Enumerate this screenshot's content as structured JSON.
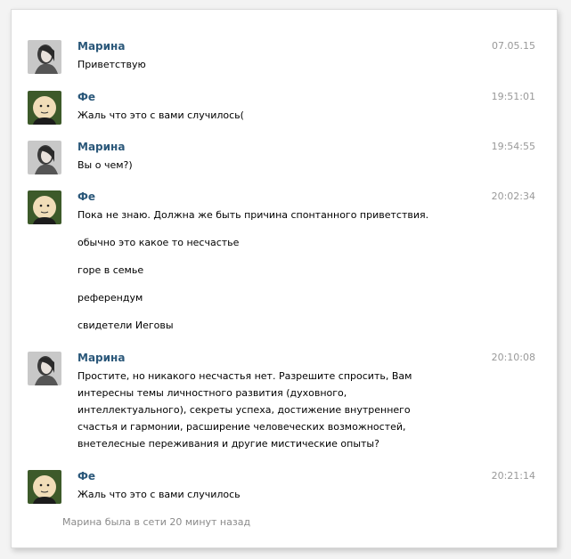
{
  "messages": [
    {
      "sender": "Марина",
      "time": "07.05.15",
      "lines": [
        "Приветствую"
      ]
    },
    {
      "sender": "Фе",
      "time": "19:51:01",
      "lines": [
        "Жаль что это с вами случилось("
      ]
    },
    {
      "sender": "Марина",
      "time": "19:54:55",
      "lines": [
        "Вы о чем?)"
      ]
    },
    {
      "sender": "Фе",
      "time": "20:02:34",
      "lines": [
        "Пока не знаю. Должна же быть причина спонтанного приветствия.",
        "обычно это какое то несчастье",
        "горе в семье",
        "референдум",
        "свидетели Иеговы"
      ]
    },
    {
      "sender": "Марина",
      "time": "20:10:08",
      "lines": [
        "Простите, но никакого несчастья нет. Разрешите спросить, Вам",
        "интересны темы личностного развития (духовного,",
        "интеллектуального), секреты успеха, достижение внутреннего",
        "счастья и гармонии, расширение человеческих возможностей,",
        "внетелесные переживания и другие мистические опыты?"
      ]
    },
    {
      "sender": "Фе",
      "time": "20:21:14",
      "lines": [
        "Жаль что это с вами случилось"
      ]
    }
  ],
  "status_text": "Марина была в сети 20 минут назад",
  "colors": {
    "name": "#2b587a",
    "time": "#999999",
    "status": "#8a8a8a"
  },
  "icons": {
    "marina_avatar": "woman-photo-avatar",
    "fe_avatar": "cartoon-character-avatar"
  }
}
